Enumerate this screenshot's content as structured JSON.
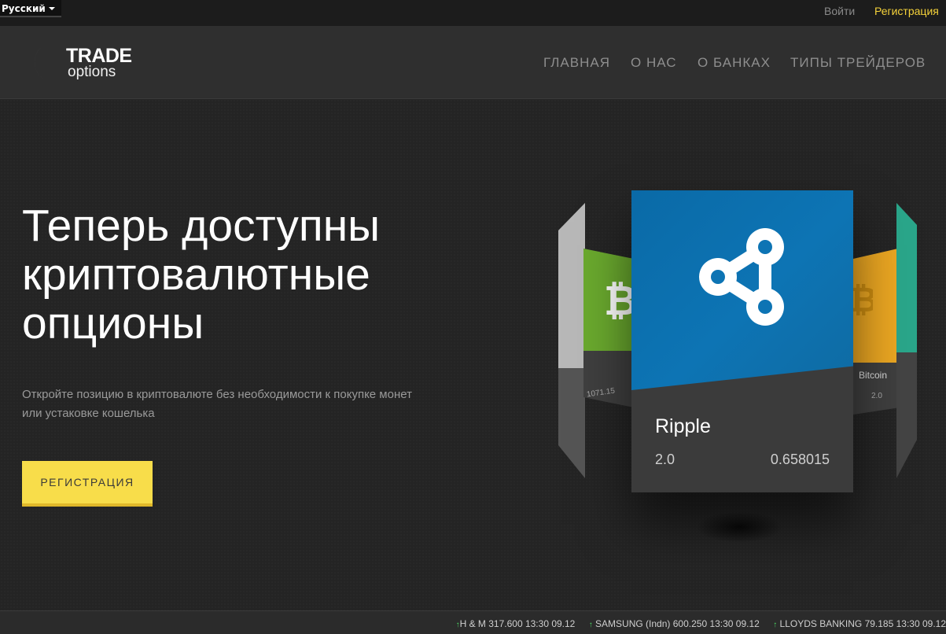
{
  "topbar": {
    "language": "Русский",
    "login": "Войти",
    "register": "Регистрация"
  },
  "logo": {
    "word1": "TRADE",
    "word2": "options"
  },
  "nav": {
    "items": [
      {
        "label": "ГЛАВНАЯ"
      },
      {
        "label": "О НАС"
      },
      {
        "label": "О БАНКАХ"
      },
      {
        "label": "ТИПЫ ТРЕЙДЕРОВ"
      }
    ]
  },
  "hero": {
    "headline_line1": "Теперь доступны",
    "headline_line2": "криптовалютные",
    "headline_line3": "опционы",
    "subtext_line1": "Откройте позицию в криптовалюте без необходимости к покупке монет",
    "subtext_line2": "или устаковке кошелька",
    "button": "РЕГИСТРАЦИЯ"
  },
  "carousel": {
    "main_card": {
      "title": "Ripple",
      "left_value": "2.0",
      "right_value": "0.658015"
    },
    "right_card_label": "Bitcoin",
    "right_card_value": "2.0",
    "left_card_value": "1071.15"
  },
  "ticker": {
    "items": [
      {
        "text": "H & M 317.600 13:30 09.12"
      },
      {
        "text": "SAMSUNG (Indn) 600.250 13:30 09.12"
      },
      {
        "text": "LLOYDS BANKING 79.185 13:30 09.12"
      }
    ]
  },
  "colors": {
    "accent": "#f8dd4a",
    "ripple_blue": "#0d74b4",
    "bitcoin_green": "#6aa92e",
    "orange": "#eaa622",
    "teal": "#2aa68a",
    "up_arrow": "#4cd964"
  }
}
